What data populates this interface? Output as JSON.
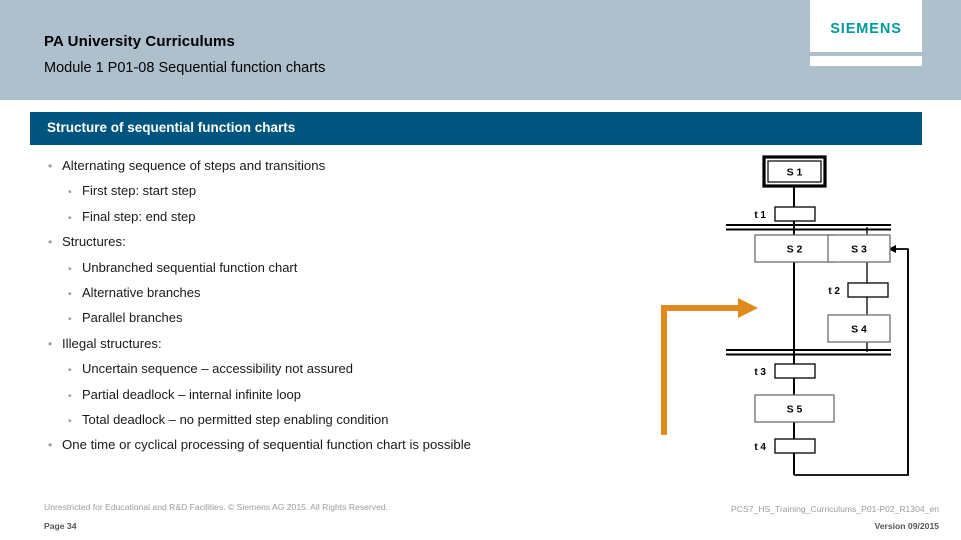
{
  "header": {
    "title": "PA University Curriculums",
    "subtitle": "Module 1 P01-08 Sequential function charts",
    "band_color": "#afc0cd",
    "logo": {
      "text": "SIEMENS",
      "color": "#009999"
    }
  },
  "section": {
    "title": "Structure of sequential function charts",
    "bar_color": "#00557f"
  },
  "bullets": [
    {
      "level": 1,
      "text": "Alternating sequence of steps and transitions"
    },
    {
      "level": 2,
      "text": "First step: start step"
    },
    {
      "level": 2,
      "text": "Final step: end step"
    },
    {
      "level": 1,
      "text": "Structures:"
    },
    {
      "level": 2,
      "text": "Unbranched sequential function chart"
    },
    {
      "level": 2,
      "text": "Alternative branches"
    },
    {
      "level": 2,
      "text": "Parallel branches"
    },
    {
      "level": 1,
      "text": "Illegal structures:"
    },
    {
      "level": 2,
      "text": "Uncertain sequence – accessibility not assured"
    },
    {
      "level": 2,
      "text": "Partial deadlock – internal infinite loop"
    },
    {
      "level": 2,
      "text": "Total deadlock – no permitted step enabling condition"
    },
    {
      "level": 1,
      "text": "One time or cyclical processing of sequential function chart is possible"
    }
  ],
  "diagram": {
    "type": "sequential-function-chart",
    "accent_color": "#e08a1e",
    "steps": [
      {
        "id": "s1",
        "label": "S 1",
        "kind": "start-step"
      },
      {
        "id": "s2",
        "label": "S 2",
        "kind": "step"
      },
      {
        "id": "s3",
        "label": "S 3",
        "kind": "step"
      },
      {
        "id": "s4",
        "label": "S 4",
        "kind": "step"
      },
      {
        "id": "s5",
        "label": "S 5",
        "kind": "step"
      }
    ],
    "transitions": [
      {
        "id": "t1",
        "label": "t 1"
      },
      {
        "id": "t2",
        "label": "t 2"
      },
      {
        "id": "t3",
        "label": "t 3"
      },
      {
        "id": "t4",
        "label": "t 4"
      }
    ],
    "annotation_arrow": "orange-pointer-arrow",
    "feedback_arrow": "loop-back-to-s3"
  },
  "footer": {
    "legal": "Unrestricted for Educational and R&D Facilities. © Siemens AG 2015. All Rights Reserved.",
    "page": "Page 34",
    "document": "PCS7_HS_Training_Curriculums_P01-P02_R1304_en",
    "version": "Version 09/2015"
  }
}
